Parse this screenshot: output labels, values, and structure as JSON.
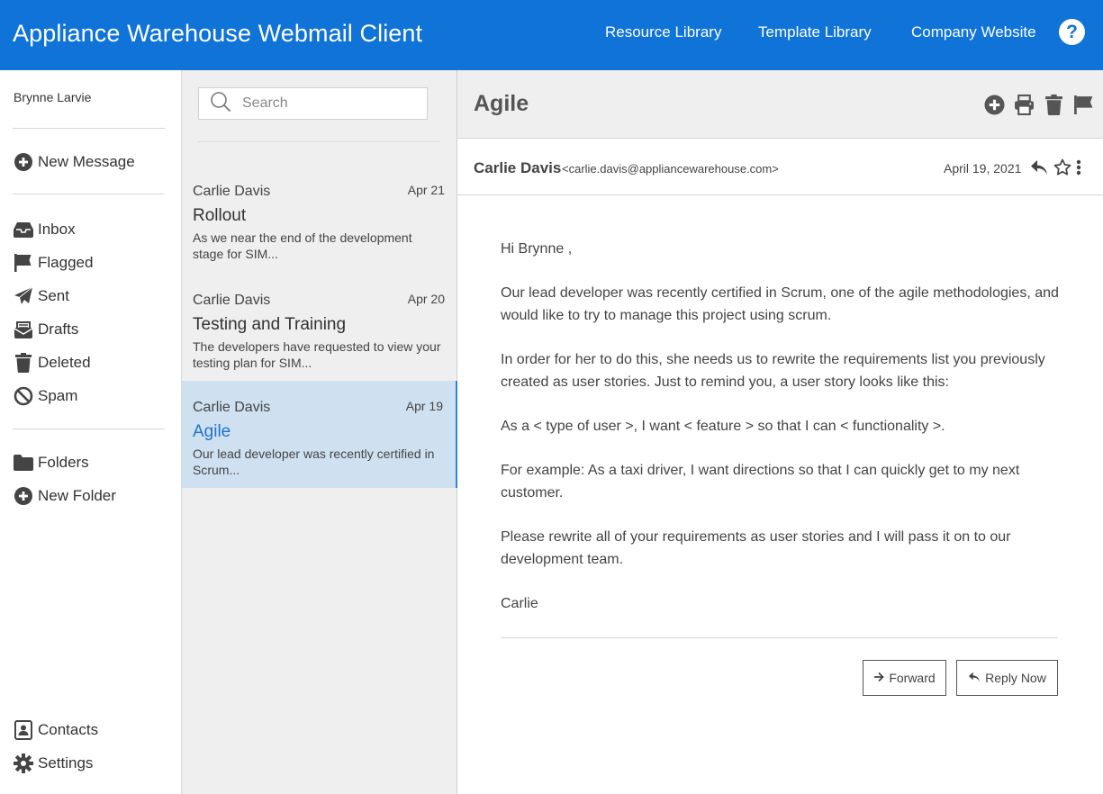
{
  "header": {
    "title": "Appliance Warehouse Webmail Client",
    "links": [
      "Resource Library",
      "Template Library",
      "Company Website"
    ],
    "help_label": "?"
  },
  "sidebar": {
    "user_name": "Brynne Larvie",
    "new_message": "New Message",
    "mailboxes": [
      {
        "label": "Inbox",
        "icon": "inbox-icon"
      },
      {
        "label": "Flagged",
        "icon": "flag-icon"
      },
      {
        "label": "Sent",
        "icon": "paper-plane-icon"
      },
      {
        "label": "Drafts",
        "icon": "drafts-icon"
      },
      {
        "label": "Deleted",
        "icon": "trash-icon"
      },
      {
        "label": "Spam",
        "icon": "ban-icon"
      }
    ],
    "folders": "Folders",
    "new_folder": "New Folder",
    "contacts": "Contacts",
    "settings": "Settings"
  },
  "search": {
    "placeholder": "Search"
  },
  "messages": [
    {
      "from": "Carlie Davis",
      "date": "Apr 21",
      "subject": "Rollout",
      "preview": "As we near the end of the development stage for SIM..."
    },
    {
      "from": "Carlie Davis",
      "date": "Apr 20",
      "subject": "Testing and Training",
      "preview": "The developers have requested to view your testing plan for SIM..."
    },
    {
      "from": "Carlie Davis",
      "date": "Apr 19",
      "subject": "Agile",
      "preview": "Our lead developer was recently certified in Scrum...",
      "selected": true
    }
  ],
  "reader": {
    "subject": "Agile",
    "toolbar": [
      "add-circle-icon",
      "print-icon",
      "trash-icon",
      "flag-icon"
    ],
    "sender_name": "Carlie Davis",
    "sender_email": "<carlie.davis@appliancewarehouse.com>",
    "date": "April 19, 2021",
    "body": [
      "Hi Brynne ,",
      "Our lead developer was recently certified in Scrum, one of the agile methodologies, and would like to try to manage this project using scrum.",
      "In order for her to do this, she needs us to rewrite the requirements list you previously created as user stories. Just to remind you, a user story looks like this:",
      "As a < type of user >, I want < feature > so that I can < functionality >.",
      "For example: As a taxi driver, I want directions so that I can quickly get to my next customer.",
      "Please rewrite all of your requirements as user stories and I will pass it on to our development team.",
      "Carlie"
    ],
    "forward_label": "Forward",
    "reply_label": "Reply Now"
  },
  "colors": {
    "header_bg": "#0f73d8",
    "selected_bg": "#cfe0f1",
    "accent": "#1f73cc"
  }
}
